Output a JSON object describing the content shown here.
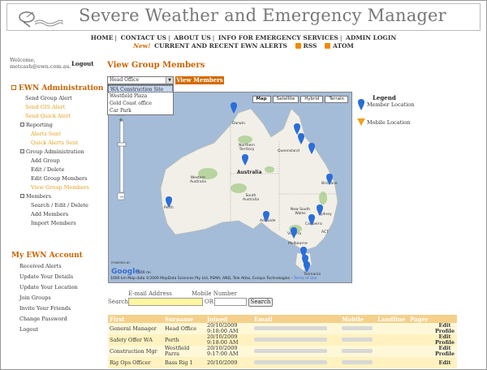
{
  "header": {
    "title": "Severe Weather and Emergency Manager"
  },
  "topnav": {
    "items": [
      "HOME",
      "CONTACT US",
      "ABOUT US",
      "INFO FOR EMERGENCY SERVICES",
      "ADMIN LOGIN"
    ],
    "new_label": "New!",
    "alerts_label": "CURRENT AND RECENT EWN ALERTS",
    "rss_label": "RSS",
    "atom_label": "ATOM"
  },
  "user": {
    "welcome": "Welcome,",
    "email": "metcash@ewn.com.au.",
    "logout": "Logout"
  },
  "sidebar": {
    "admin_title": "EWN Administration",
    "admin_items": [
      {
        "label": "Send Group Alert",
        "orange": false
      },
      {
        "label": "Send GIS Alert",
        "orange": true
      },
      {
        "label": "Send Quick Alert",
        "orange": true
      }
    ],
    "reporting": "Reporting",
    "reporting_items": [
      "Alerts Sent",
      "Quick Alerts Sent"
    ],
    "group_admin": "Group Administration",
    "group_items": [
      "Add Group",
      "Edit / Delete",
      "Edit Group Members",
      "View Group Members"
    ],
    "members": "Members",
    "member_items": [
      "Search / Edit / Delete",
      "Add Members",
      "Import Members"
    ],
    "account_title": "My EWN Account",
    "account_items": [
      "Received Alerts",
      "Update Your Details",
      "Update Your Location",
      "Join Groups",
      "Invite Your Friends",
      "Change Password",
      "Logout"
    ]
  },
  "main": {
    "title": "View Group Members",
    "group_select": "Head Office",
    "group_options": [
      "WA Construction Site",
      "Westfield Plaza",
      "Gold Coast office",
      "Car Park"
    ],
    "view_button": "View Members"
  },
  "map": {
    "buttons": [
      "Map",
      "Satellite",
      "Hybrid",
      "Terrain"
    ],
    "active": "Map",
    "labels": {
      "darwin": "Darwin",
      "nt": "Northern Territory",
      "queensland": "Queensland",
      "wa": "Western Australia",
      "australia": "Australia",
      "sa": "South Australia",
      "nsw": "New South Wales",
      "victoria": "Victoria",
      "tasmania": "Tasmania",
      "brisbane": "Brisbane",
      "sydney": "Sydney",
      "adelaide": "Adelaide",
      "melbourne": "Melbourne",
      "canberra": "Canberra",
      "act": "ACT",
      "perth": "Perth"
    },
    "powered": "POWERED BY",
    "google": "Google",
    "scale": "500 mi",
    "footer": "1000 km  Map data ©2009 MapData Sciences Pty Ltd, PSMA, AND, Tele Atlas, Europa Technologies -",
    "terms": "Terms of Use"
  },
  "legend": {
    "title": "Legend",
    "member": "Member Location",
    "mobile": "Mobile Location"
  },
  "search": {
    "email_label": "E-mail Address",
    "mobile_label": "Mobile Number",
    "search_label": "Search:",
    "or": "OR",
    "button": "Search"
  },
  "table": {
    "headers": [
      "First",
      "Surname",
      "Joined",
      "Email",
      "Mobile",
      "Landline",
      "Pager",
      ""
    ],
    "rows": [
      {
        "first": "General Manager",
        "surname": "Head Office",
        "joined_date": "20/10/2009",
        "joined_time": "9:18:00 AM",
        "edit": "Edit",
        "profile": "Profile"
      },
      {
        "first": "Safety Offer WA",
        "surname": "Perth",
        "joined_date": "20/10/2009",
        "joined_time": "9:18:00 AM",
        "edit": "Edit",
        "profile": "Profile"
      },
      {
        "first": "Construction Mgr",
        "surname": "Westfield Parra",
        "joined_date": "20/10/2009",
        "joined_time": "9:17:00 AM",
        "edit": "Edit",
        "profile": "Profile"
      },
      {
        "first": "Rig Ops Officer",
        "surname": "Bass Rig 1",
        "joined_date": "20/10/2009",
        "joined_time": "",
        "edit": "Edit",
        "profile": ""
      }
    ]
  },
  "colors": {
    "accent": "#c86400",
    "button": "#d46a00",
    "link_orange": "#e0a020",
    "table_header": "#f4d08a",
    "map_water": "#a4bcd8",
    "map_land": "#f2efe8",
    "pin": "#2a6ed8"
  }
}
